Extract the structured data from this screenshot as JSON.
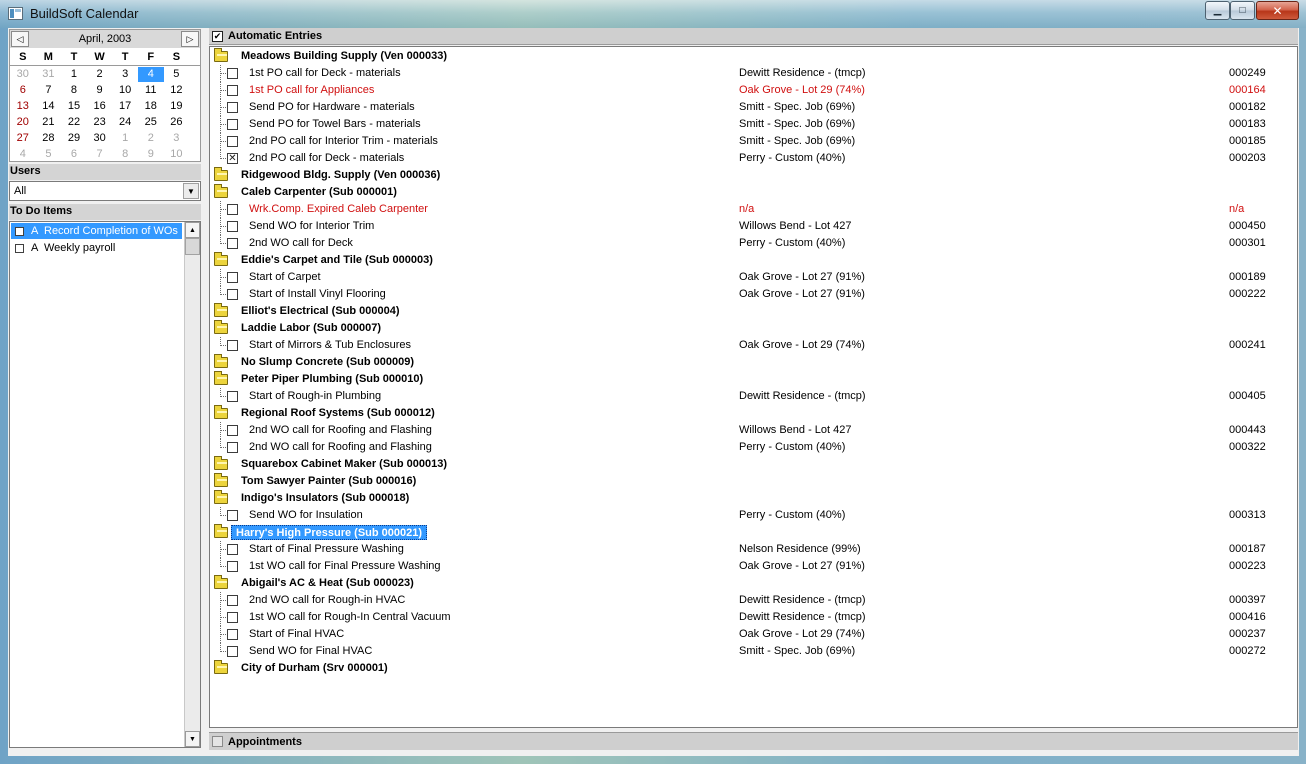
{
  "window": {
    "title": "BuildSoft Calendar",
    "min_glyph": "▁",
    "max_glyph": "□",
    "close_glyph": "✕"
  },
  "calendar": {
    "month_label": "April, 2003",
    "prev_glyph": "◁",
    "next_glyph": "▷",
    "day_headers": [
      "S",
      "M",
      "T",
      "W",
      "T",
      "F",
      "S"
    ],
    "weeks": [
      [
        "30",
        "31",
        "1",
        "2",
        "3",
        "4",
        "5"
      ],
      [
        "6",
        "7",
        "8",
        "9",
        "10",
        "11",
        "12"
      ],
      [
        "13",
        "14",
        "15",
        "16",
        "17",
        "18",
        "19"
      ],
      [
        "20",
        "21",
        "22",
        "23",
        "24",
        "25",
        "26"
      ],
      [
        "27",
        "28",
        "29",
        "30",
        "1",
        "2",
        "3"
      ],
      [
        "4",
        "5",
        "6",
        "7",
        "8",
        "9",
        "10"
      ]
    ],
    "selected_day": "4"
  },
  "users": {
    "label": "Users",
    "value": "All",
    "drop_glyph": "▼"
  },
  "todo": {
    "label": "To Do Items",
    "items": [
      {
        "priority": "A",
        "text": "Record Completion of WOs",
        "selected": true
      },
      {
        "priority": "A",
        "text": "Weekly payroll",
        "selected": false
      }
    ],
    "scroll_up": "▲",
    "scroll_down": "▼"
  },
  "auto_entries": {
    "label": "Automatic Entries",
    "check_glyph": "✔"
  },
  "appointments": {
    "label": "Appointments"
  },
  "tree": [
    {
      "type": "group",
      "label": "Meadows Building Supply (Ven 000033)"
    },
    {
      "type": "task",
      "label": "1st PO call for Deck - materials",
      "job": "Dewitt Residence - (tmcp)",
      "num": "000249"
    },
    {
      "type": "task",
      "label": "1st PO call for Appliances",
      "job": "Oak Grove - Lot 29 (74%)",
      "num": "000164",
      "red": true
    },
    {
      "type": "task",
      "label": "Send PO for Hardware - materials",
      "job": "Smitt - Spec. Job (69%)",
      "num": "000182"
    },
    {
      "type": "task",
      "label": "Send PO for Towel Bars - materials",
      "job": "Smitt - Spec. Job (69%)",
      "num": "000183"
    },
    {
      "type": "task",
      "label": "2nd PO call for Interior Trim - materials",
      "job": "Smitt - Spec. Job (69%)",
      "num": "000185"
    },
    {
      "type": "task",
      "label": "2nd PO call for Deck - materials",
      "job": "Perry - Custom (40%)",
      "num": "000203",
      "checked": true,
      "last": true
    },
    {
      "type": "group",
      "label": "Ridgewood Bldg. Supply (Ven 000036)"
    },
    {
      "type": "group",
      "label": "Caleb Carpenter (Sub 000001)"
    },
    {
      "type": "task",
      "label": "Wrk.Comp. Expired Caleb Carpenter",
      "job": "n/a",
      "num": "n/a",
      "red": true
    },
    {
      "type": "task",
      "label": "Send WO for Interior Trim",
      "job": "Willows Bend - Lot 427",
      "num": "000450"
    },
    {
      "type": "task",
      "label": "2nd WO call for Deck",
      "job": "Perry - Custom (40%)",
      "num": "000301",
      "last": true
    },
    {
      "type": "group",
      "label": "Eddie's Carpet and Tile (Sub 000003)"
    },
    {
      "type": "task",
      "label": "Start of Carpet",
      "job": "Oak Grove - Lot 27 (91%)",
      "num": "000189"
    },
    {
      "type": "task",
      "label": "Start of Install Vinyl Flooring",
      "job": "Oak Grove - Lot 27 (91%)",
      "num": "000222",
      "last": true
    },
    {
      "type": "group",
      "label": "Elliot's Electrical (Sub 000004)"
    },
    {
      "type": "group",
      "label": "Laddie Labor (Sub 000007)"
    },
    {
      "type": "task",
      "label": "Start of Mirrors & Tub Enclosures",
      "job": "Oak Grove - Lot 29 (74%)",
      "num": "000241",
      "last": true
    },
    {
      "type": "group",
      "label": "No Slump Concrete (Sub 000009)"
    },
    {
      "type": "group",
      "label": "Peter Piper Plumbing (Sub 000010)"
    },
    {
      "type": "task",
      "label": "Start of Rough-in Plumbing",
      "job": "Dewitt Residence - (tmcp)",
      "num": "000405",
      "last": true
    },
    {
      "type": "group",
      "label": "Regional Roof Systems (Sub 000012)"
    },
    {
      "type": "task",
      "label": "2nd WO call for Roofing and Flashing",
      "job": "Willows Bend - Lot 427",
      "num": "000443"
    },
    {
      "type": "task",
      "label": "2nd WO call for Roofing and Flashing",
      "job": "Perry - Custom (40%)",
      "num": "000322",
      "last": true
    },
    {
      "type": "group",
      "label": "Squarebox Cabinet Maker (Sub 000013)"
    },
    {
      "type": "group",
      "label": "Tom Sawyer Painter (Sub 000016)"
    },
    {
      "type": "group",
      "label": "Indigo's Insulators (Sub 000018)"
    },
    {
      "type": "task",
      "label": "Send WO for Insulation",
      "job": "Perry - Custom (40%)",
      "num": "000313",
      "last": true
    },
    {
      "type": "group",
      "label": "Harry's High Pressure (Sub 000021)",
      "selected": true
    },
    {
      "type": "task",
      "label": "Start of Final Pressure Washing",
      "job": "Nelson Residence (99%)",
      "num": "000187"
    },
    {
      "type": "task",
      "label": "1st WO call for Final Pressure Washing",
      "job": "Oak Grove - Lot 27 (91%)",
      "num": "000223",
      "last": true
    },
    {
      "type": "group",
      "label": "Abigail's AC & Heat (Sub 000023)"
    },
    {
      "type": "task",
      "label": "2nd WO call for Rough-in HVAC",
      "job": "Dewitt Residence - (tmcp)",
      "num": "000397"
    },
    {
      "type": "task",
      "label": "1st WO call for Rough-In Central Vacuum",
      "job": "Dewitt Residence - (tmcp)",
      "num": "000416"
    },
    {
      "type": "task",
      "label": "Start of Final HVAC",
      "job": "Oak Grove - Lot 29 (74%)",
      "num": "000237"
    },
    {
      "type": "task",
      "label": "Send WO for Final HVAC",
      "job": "Smitt - Spec. Job (69%)",
      "num": "000272",
      "last": true
    },
    {
      "type": "group",
      "label": "City of Durham (Srv 000001)"
    }
  ],
  "colors": {
    "selection": "#3399ff",
    "alert_red": "#d01010",
    "weekend_red": "#a00000"
  }
}
